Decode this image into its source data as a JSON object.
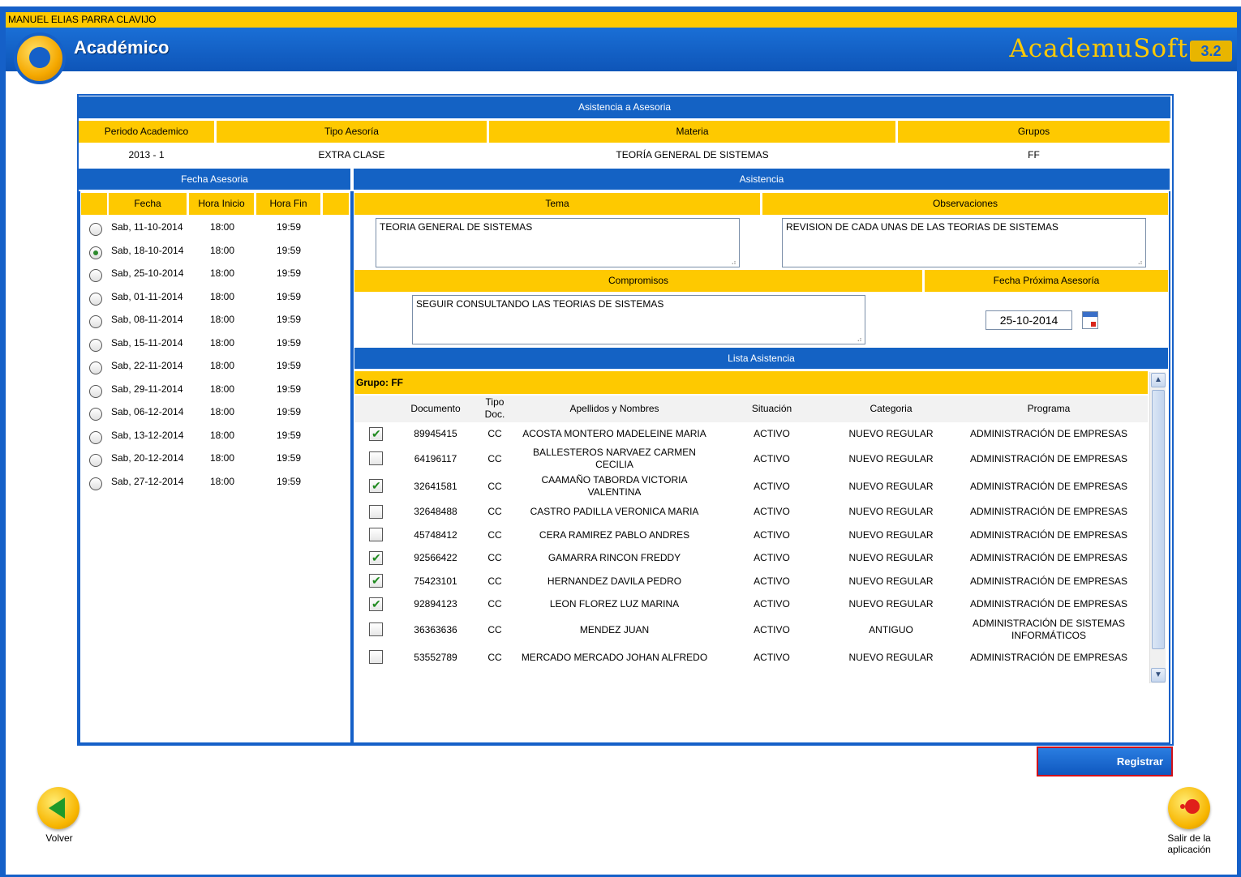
{
  "user_name": "MANUEL ELIAS PARRA CLAVIJO",
  "header": {
    "title": "Académico",
    "brand": "AcademuSoft",
    "version": "3.2"
  },
  "main": {
    "section_title": "Asistencia a Asesoria",
    "columns": [
      "Periodo Academico",
      "Tipo Aesoría",
      "Materia",
      "Grupos"
    ],
    "values": {
      "periodo": "2013 - 1",
      "tipo": "EXTRA CLASE",
      "materia": "TEORÍA GENERAL DE SISTEMAS",
      "grupo": "FF"
    }
  },
  "fecha_asesoria": {
    "title": "Fecha Asesoria",
    "headers": [
      "Fecha",
      "Hora Inicio",
      "Hora Fin"
    ],
    "rows": [
      {
        "fecha": "Sab, 11-10-2014",
        "inicio": "18:00",
        "fin": "19:59",
        "selected": false
      },
      {
        "fecha": "Sab, 18-10-2014",
        "inicio": "18:00",
        "fin": "19:59",
        "selected": true
      },
      {
        "fecha": "Sab, 25-10-2014",
        "inicio": "18:00",
        "fin": "19:59",
        "selected": false
      },
      {
        "fecha": "Sab, 01-11-2014",
        "inicio": "18:00",
        "fin": "19:59",
        "selected": false
      },
      {
        "fecha": "Sab, 08-11-2014",
        "inicio": "18:00",
        "fin": "19:59",
        "selected": false
      },
      {
        "fecha": "Sab, 15-11-2014",
        "inicio": "18:00",
        "fin": "19:59",
        "selected": false
      },
      {
        "fecha": "Sab, 22-11-2014",
        "inicio": "18:00",
        "fin": "19:59",
        "selected": false
      },
      {
        "fecha": "Sab, 29-11-2014",
        "inicio": "18:00",
        "fin": "19:59",
        "selected": false
      },
      {
        "fecha": "Sab, 06-12-2014",
        "inicio": "18:00",
        "fin": "19:59",
        "selected": false
      },
      {
        "fecha": "Sab, 13-12-2014",
        "inicio": "18:00",
        "fin": "19:59",
        "selected": false
      },
      {
        "fecha": "Sab, 20-12-2014",
        "inicio": "18:00",
        "fin": "19:59",
        "selected": false
      },
      {
        "fecha": "Sab, 27-12-2014",
        "inicio": "18:00",
        "fin": "19:59",
        "selected": false
      }
    ]
  },
  "asistencia": {
    "title": "Asistencia",
    "tema_label": "Tema",
    "tema_value": "TEORIA GENERAL DE SISTEMAS",
    "obs_label": "Observaciones",
    "obs_value": "REVISION DE CADA UNAS DE LAS TEORIAS DE SISTEMAS",
    "compromisos_label": "Compromisos",
    "compromisos_value": "SEGUIR CONSULTANDO LAS TEORIAS DE SISTEMAS",
    "fecha_prox_label": "Fecha Próxima Asesoría",
    "fecha_prox_value": "25-10-2014"
  },
  "lista": {
    "title": "Lista Asistencia",
    "grupo_label": "Grupo: FF",
    "headers": [
      "Documento",
      "Tipo Doc.",
      "Apellidos y Nombres",
      "Situación",
      "Categoria",
      "Programa"
    ],
    "rows": [
      {
        "checked": true,
        "doc": "89945415",
        "tipo": "CC",
        "nombre": "ACOSTA MONTERO MADELEINE MARIA",
        "situacion": "ACTIVO",
        "categoria": "NUEVO REGULAR",
        "programa": "ADMINISTRACIÓN DE EMPRESAS"
      },
      {
        "checked": false,
        "doc": "64196117",
        "tipo": "CC",
        "nombre": "BALLESTEROS NARVAEZ CARMEN CECILIA",
        "situacion": "ACTIVO",
        "categoria": "NUEVO REGULAR",
        "programa": "ADMINISTRACIÓN DE EMPRESAS"
      },
      {
        "checked": true,
        "doc": "32641581",
        "tipo": "CC",
        "nombre": "CAAMAÑO TABORDA VICTORIA VALENTINA",
        "situacion": "ACTIVO",
        "categoria": "NUEVO REGULAR",
        "programa": "ADMINISTRACIÓN DE EMPRESAS"
      },
      {
        "checked": false,
        "doc": "32648488",
        "tipo": "CC",
        "nombre": "CASTRO PADILLA VERONICA MARIA",
        "situacion": "ACTIVO",
        "categoria": "NUEVO REGULAR",
        "programa": "ADMINISTRACIÓN DE EMPRESAS"
      },
      {
        "checked": false,
        "doc": "45748412",
        "tipo": "CC",
        "nombre": "CERA RAMIREZ PABLO ANDRES",
        "situacion": "ACTIVO",
        "categoria": "NUEVO REGULAR",
        "programa": "ADMINISTRACIÓN DE EMPRESAS"
      },
      {
        "checked": true,
        "doc": "92566422",
        "tipo": "CC",
        "nombre": "GAMARRA RINCON FREDDY",
        "situacion": "ACTIVO",
        "categoria": "NUEVO REGULAR",
        "programa": "ADMINISTRACIÓN DE EMPRESAS"
      },
      {
        "checked": true,
        "doc": "75423101",
        "tipo": "CC",
        "nombre": "HERNANDEZ DAVILA PEDRO",
        "situacion": "ACTIVO",
        "categoria": "NUEVO REGULAR",
        "programa": "ADMINISTRACIÓN DE EMPRESAS"
      },
      {
        "checked": true,
        "doc": "92894123",
        "tipo": "CC",
        "nombre": "LEON FLOREZ LUZ MARINA",
        "situacion": "ACTIVO",
        "categoria": "NUEVO REGULAR",
        "programa": "ADMINISTRACIÓN DE EMPRESAS"
      },
      {
        "checked": false,
        "doc": "36363636",
        "tipo": "CC",
        "nombre": "MENDEZ JUAN",
        "situacion": "ACTIVO",
        "categoria": "ANTIGUO",
        "programa": "ADMINISTRACIÓN DE SISTEMAS INFORMÁTICOS"
      },
      {
        "checked": false,
        "doc": "53552789",
        "tipo": "CC",
        "nombre": "MERCADO MERCADO JOHAN ALFREDO",
        "situacion": "ACTIVO",
        "categoria": "NUEVO REGULAR",
        "programa": "ADMINISTRACIÓN DE EMPRESAS"
      }
    ]
  },
  "actions": {
    "registrar": "Registrar",
    "volver": "Volver",
    "salir": "Salir de la aplicación"
  },
  "colors": {
    "blue": "#1462c4",
    "yellow": "#fec900",
    "red_outline": "#d0101a"
  }
}
